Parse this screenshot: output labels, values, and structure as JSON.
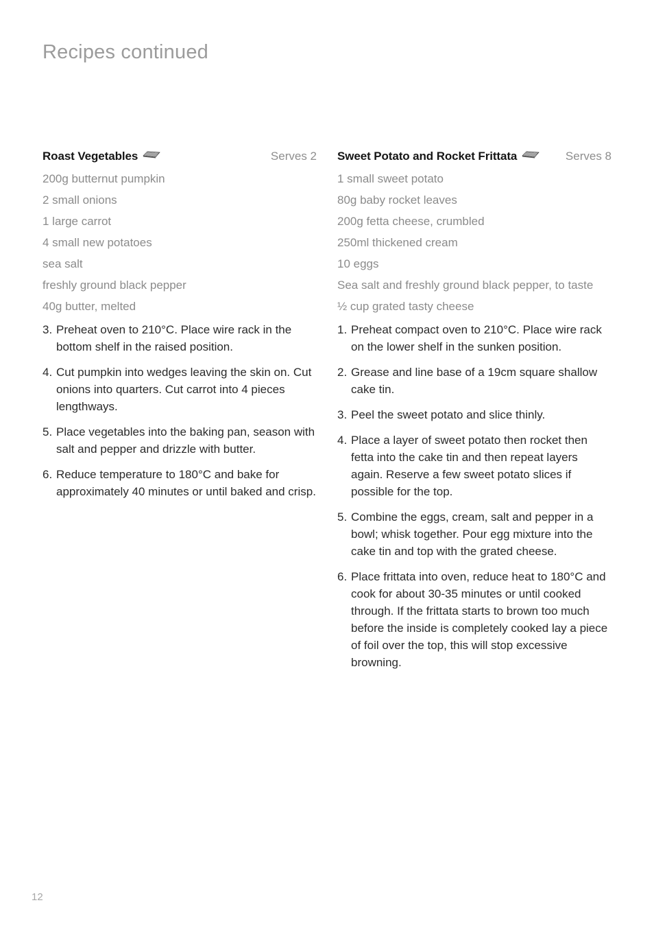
{
  "page": {
    "title": "Recipes continued",
    "number": "12"
  },
  "icons": {
    "rack": "baking-rack-icon"
  },
  "recipes": [
    {
      "title": "Roast Vegetables",
      "serves": "Serves 2",
      "icon": "baking-rack-icon",
      "ingredients": [
        "200g butternut pumpkin",
        "2 small onions",
        "1 large carrot",
        "4 small new potatoes",
        "sea salt",
        "freshly ground black pepper",
        "40g butter, melted"
      ],
      "steps": [
        {
          "number": "3.",
          "text": "Preheat oven to 210°C. Place wire rack in the bottom shelf in the raised position."
        },
        {
          "number": "4.",
          "text": "Cut pumpkin into wedges leaving the skin on. Cut onions into quarters. Cut carrot into 4 pieces lengthways."
        },
        {
          "number": "5.",
          "text": "Place vegetables into the baking pan, season with salt and pepper and drizzle with butter."
        },
        {
          "number": "6.",
          "text": "Reduce temperature to 180°C and bake for approximately 40 minutes or until baked and crisp."
        }
      ]
    },
    {
      "title": "Sweet Potato and Rocket Frittata",
      "serves": "Serves 8",
      "icon": "baking-rack-icon",
      "ingredients": [
        "1 small sweet potato",
        "80g baby rocket leaves",
        "200g fetta cheese, crumbled",
        "250ml thickened cream",
        "10 eggs",
        "Sea salt and freshly ground black pepper, to taste",
        "½ cup grated tasty cheese"
      ],
      "steps": [
        {
          "number": "1.",
          "text": "Preheat compact oven to 210°C. Place wire rack on the lower shelf in the sunken position."
        },
        {
          "number": "2.",
          "text": "Grease and line base of a 19cm square shallow cake tin."
        },
        {
          "number": "3.",
          "text": "Peel the sweet potato and slice thinly."
        },
        {
          "number": "4.",
          "text": "Place a layer of sweet potato then rocket then fetta into the cake tin and then repeat layers again. Reserve a few sweet potato slices if possible for the top."
        },
        {
          "number": "5.",
          "text": "Combine the eggs, cream, salt and pepper in a bowl; whisk together. Pour egg mixture into the cake tin and top with the grated cheese."
        },
        {
          "number": "6.",
          "text": "Place frittata into oven, reduce heat to 180°C and cook for about 30-35 minutes or until cooked through. If the frittata starts to brown too much before the inside is completely cooked lay a piece of foil over the top, this will stop excessive browning."
        }
      ]
    }
  ]
}
